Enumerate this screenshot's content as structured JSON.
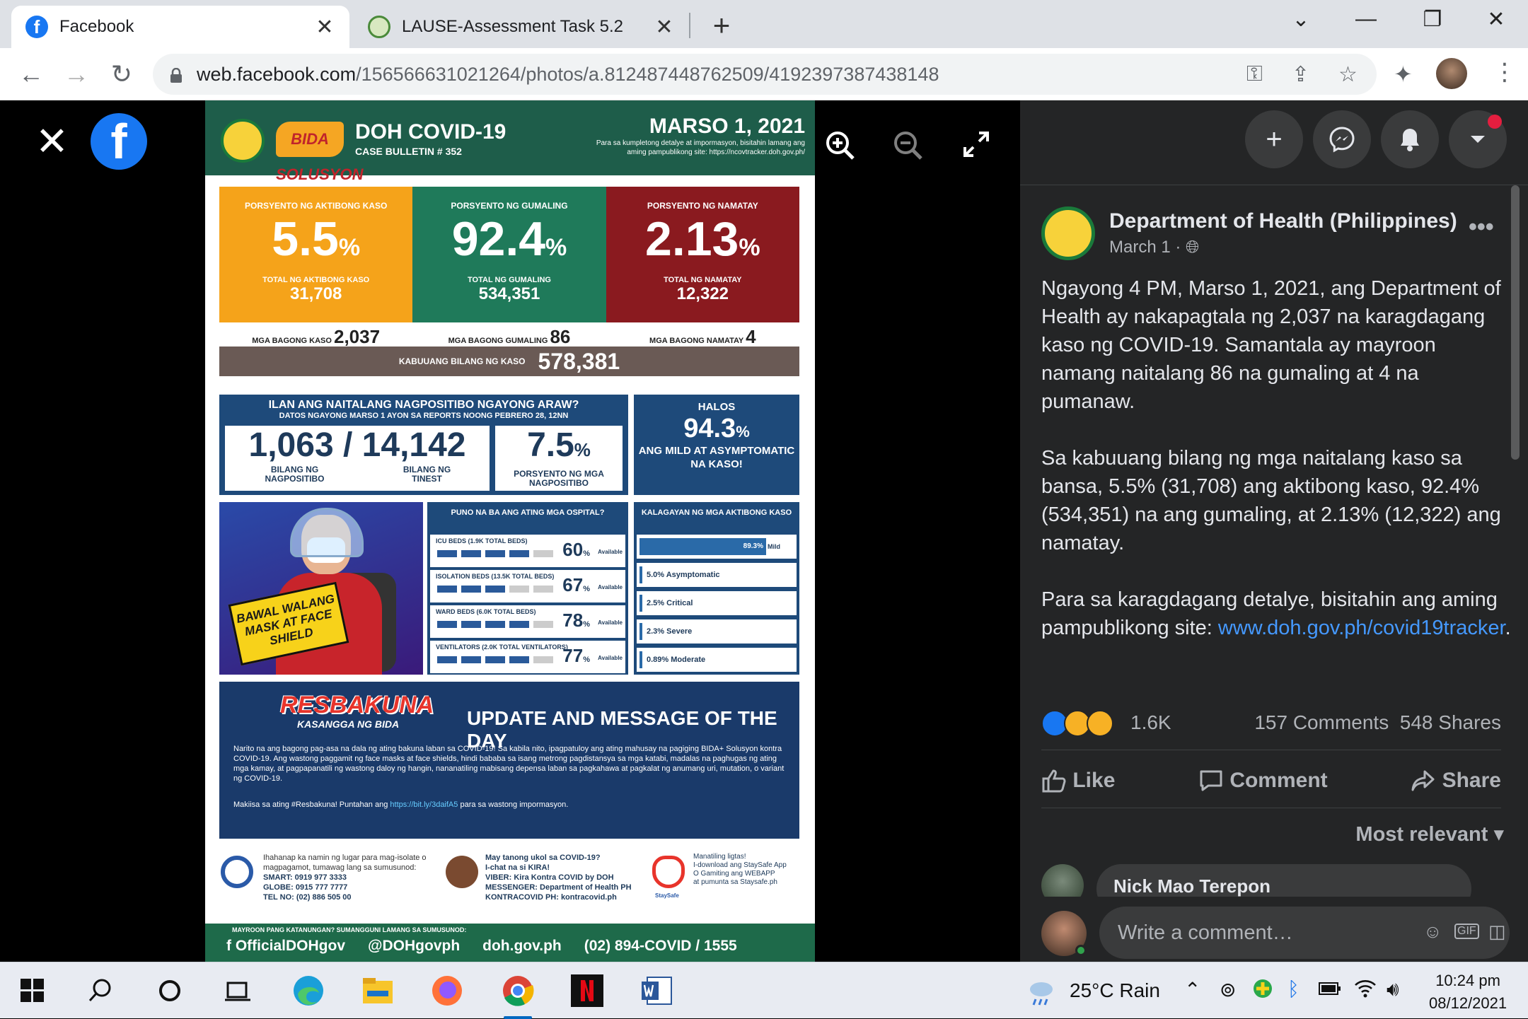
{
  "browser": {
    "tabs": [
      {
        "title": "Facebook",
        "active": true,
        "icon": "facebook-icon"
      },
      {
        "title": "LAUSE-Assessment Task 5.2",
        "active": false,
        "icon": "seal-icon"
      }
    ],
    "url_domain": "web.facebook.com",
    "url_path": "/156566631021264/photos/a.812487448762509/4192397387438148"
  },
  "infographic": {
    "header_title": "DOH COVID-19",
    "header_sub": "CASE BULLETIN # 352",
    "bida_logo": "BIDA SOLUSYON",
    "date": "MARSO 1, 2021",
    "note": "Para sa kumpletong detalye at impormasyon, bisitahin lamang ang aming pampublikong site: https://ncovtracker.doh.gov.ph/",
    "stats": [
      {
        "label": "PORSYENTO NG AKTIBONG KASO",
        "value": "5.5",
        "total_label": "TOTAL NG AKTIBONG KASO",
        "total": "31,708",
        "color": "#f5a31a"
      },
      {
        "label": "PORSYENTO NG GUMALING",
        "value": "92.4",
        "total_label": "TOTAL NG GUMALING",
        "total": "534,351",
        "color": "#1f7a5a"
      },
      {
        "label": "PORSYENTO NG NAMATAY",
        "value": "2.13",
        "total_label": "TOTAL NG NAMATAY",
        "total": "12,322",
        "color": "#8a1a1f"
      }
    ],
    "pct": "%",
    "new": [
      {
        "label": "MGA BAGONG KASO",
        "value": "2,037"
      },
      {
        "label": "MGA BAGONG GUMALING",
        "value": "86"
      },
      {
        "label": "MGA BAGONG NAMATAY",
        "value": "4"
      }
    ],
    "total_label": "KABUUANG BILANG NG KASO",
    "total_value": "578,381",
    "pos_title": "ILAN ANG NAITALANG NAGPOSITIBO NGAYONG ARAW?",
    "pos_sub": "DATOS NGAYONG MARSO 1 AYON SA REPORTS NOONG PEBRERO 28, 12NN",
    "pos_num": "1,063",
    "pos_slash": "/",
    "tested_num": "14,142",
    "pos_label": "BILANG NG NAGPOSITIBO",
    "tested_label": "BILANG NG TINEST",
    "pos_pct": "7.5",
    "pos_pct_label": "PORSYENTO NG MGA NAGPOSITIBO",
    "halos_title": "HALOS",
    "halos_value": "94.3",
    "halos_text": "ANG MILD AT ASYMPTOMATIC NA KASO!",
    "sign_text": "BAWAL WALANG MASK AT FACE SHIELD",
    "hosp_title": "PUNO NA BA ANG ATING MGA OSPITAL?",
    "hosp": [
      {
        "label": "ICU BEDS (1.9K TOTAL BEDS)",
        "pct": "60",
        "filled": 4,
        "empty": 1
      },
      {
        "label": "ISOLATION BEDS (13.5K TOTAL BEDS)",
        "pct": "67",
        "filled": 3,
        "empty": 2
      },
      {
        "label": "WARD BEDS (6.0K TOTAL BEDS)",
        "pct": "78",
        "filled": 4,
        "empty": 1
      },
      {
        "label": "VENTILATORS (2.0K TOTAL VENTILATORS)",
        "pct": "77",
        "filled": 4,
        "empty": 1
      }
    ],
    "available": "Available",
    "kal_title": "KALAGAYAN NG MGA AKTIBONG KASO",
    "kal": [
      {
        "label": "89.3%",
        "side": "Mild",
        "fraction": 0.893
      },
      {
        "label": "5.0% Asymptomatic",
        "fraction": 0.05
      },
      {
        "label": "2.5% Critical",
        "fraction": 0.025
      },
      {
        "label": "2.3% Severe",
        "fraction": 0.023
      },
      {
        "label": "0.89% Moderate",
        "fraction": 0.0089
      }
    ],
    "resb_logo": "RESBAKUNA",
    "resb_logo_sub": "KASANGGA NG BIDA",
    "resb_title": "UPDATE AND MESSAGE OF THE DAY",
    "resb_body": "Narito na ang bagong pag-asa na dala ng ating bakuna laban sa COVID-19! Sa kabila nito, ipagpatuloy ang ating mahusay na pagiging BIDA+ Solusyon kontra COVID-19. Ang wastong paggamit ng face masks at face shields, hindi bababa sa isang metrong pagdistansya sa mga katabi, madalas na paghugas ng ating mga kamay, at pagpapanatili ng wastong daloy ng hangin, nananatiling mabisang depensa laban sa pagkahawa at pagkalat ng anumang uri, mutation, o variant ng COVID-19.",
    "resb_mak": "Makiisa sa ating #Resbakuna! Puntahan ang",
    "resb_link": "https://bit.ly/3daifA5",
    "resb_mak2": "para sa wastong impormasyon.",
    "contact1": "Ihahanap ka namin ng lugar para mag-isolate o magpagamot, tumawag lang sa sumusunod:",
    "contact1_lines": "SMART: 0919 977 3333\nGLOBE: 0915 777 7777\nTEL NO: (02) 886 505 00",
    "contact2": "May tanong ukol sa COVID-19?\nI-chat na si KIRA!\nVIBER: Kira Kontra COVID by DOH\nMESSENGER: Department of Health PH\nKONTRACOVID PH: kontracovid.ph",
    "contact3": "Manatiling ligtas!\nI-download ang StaySafe App\nO Gamiting ang WEBAPP\nat pumunta sa Staysafe.ph",
    "staysafe": "StaySafe",
    "footer_q": "MAYROON PANG KATANUNGAN? SUMANGGUNI LAMANG SA SUMUSUNOD:",
    "footer_links": [
      "f OfficialDOHgov",
      "@DOHgovph",
      "doh.gov.ph",
      "(02) 894-COVID  /  1555"
    ]
  },
  "post": {
    "page_name": "Department of Health (Philippines)",
    "date": "March 1 ·",
    "text": "Ngayong 4 PM, Marso 1, 2021, ang Department of Health ay nakapagtala ng 2,037 na karagdagang kaso ng COVID-19. Samantala ay mayroon namang naitalang 86 na gumaling at 4 na pumanaw.\n\nSa kabuuang bilang ng mga naitalang kaso sa bansa, 5.5% (31,708) ang aktibong kaso, 92.4% (534,351) na ang gumaling, at 2.13% (12,322) ang namatay.\n\nPara sa karagdagang detalye, bisitahin ang aming pampublikong site: ",
    "link": "www.doh.gov.ph/covid19tracker",
    "link_after": ".",
    "reactions": "1.6K",
    "comments": "157 Comments",
    "shares": "548 Shares",
    "like": "Like",
    "comment": "Comment",
    "share": "Share",
    "sort": "Most relevant",
    "first_commenter": "Nick Mao Terepon",
    "write_placeholder": "Write a comment…",
    "gif": "GIF"
  },
  "taskbar": {
    "weather": "25°C  Rain",
    "time": "10:24 pm",
    "date": "08/12/2021"
  },
  "colors": {
    "fb_blue": "#1877f2",
    "dark_bg": "#242526",
    "link": "#4599ff"
  }
}
